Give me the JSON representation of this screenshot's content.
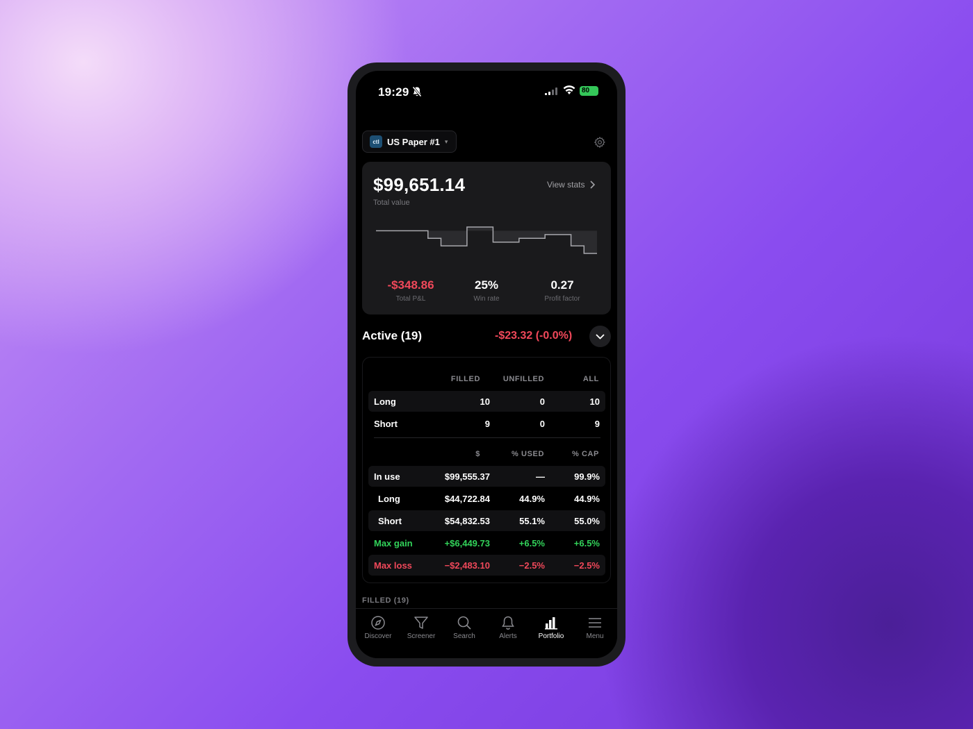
{
  "status_bar": {
    "time": "19:29",
    "battery": "80"
  },
  "account": {
    "logo_text": "ctl",
    "name": "US Paper #1"
  },
  "summary": {
    "total_value": "$99,651.14",
    "total_value_label": "Total value",
    "view_stats_label": "View stats",
    "stats": [
      {
        "value": "-$348.86",
        "label": "Total P&L"
      },
      {
        "value": "25%",
        "label": "Win rate"
      },
      {
        "value": "0.27",
        "label": "Profit factor"
      }
    ]
  },
  "equity_sparkline": {
    "type": "line",
    "values": [
      0,
      0,
      0,
      0,
      -2,
      -4,
      -4,
      1,
      1,
      -3,
      -3,
      -2,
      -2,
      -1,
      -1,
      -4,
      -6
    ]
  },
  "active": {
    "title": "Active (19)",
    "pnl": "-$23.32 (-0.0%)"
  },
  "positions_table": {
    "headers": [
      "FILLED",
      "UNFILLED",
      "ALL"
    ],
    "rows": [
      {
        "label": "Long",
        "filled": "10",
        "unfilled": "0",
        "all": "10"
      },
      {
        "label": "Short",
        "filled": "9",
        "unfilled": "0",
        "all": "9"
      }
    ]
  },
  "capital_table": {
    "headers": [
      "$",
      "% USED",
      "% CAP"
    ],
    "rows": [
      {
        "label": "In use",
        "amount": "$99,555.37",
        "used": "—",
        "cap": "99.9%"
      },
      {
        "label": "Long",
        "amount": "$44,722.84",
        "used": "44.9%",
        "cap": "44.9%"
      },
      {
        "label": "Short",
        "amount": "$54,832.53",
        "used": "55.1%",
        "cap": "55.0%"
      },
      {
        "label": "Max gain",
        "amount": "+$6,449.73",
        "used": "+6.5%",
        "cap": "+6.5%"
      },
      {
        "label": "Max loss",
        "amount": "−$2,483.10",
        "used": "−2.5%",
        "cap": "−2.5%"
      }
    ]
  },
  "filled_section": {
    "label": "FILLED (19)"
  },
  "tabbar": {
    "tabs": [
      {
        "label": "Discover",
        "icon": "compass-icon"
      },
      {
        "label": "Screener",
        "icon": "filter-icon"
      },
      {
        "label": "Search",
        "icon": "search-icon"
      },
      {
        "label": "Alerts",
        "icon": "bell-icon"
      },
      {
        "label": "Portfolio",
        "icon": "bar-chart-icon",
        "active": true
      },
      {
        "label": "Menu",
        "icon": "menu-icon"
      }
    ]
  },
  "colors": {
    "negative": "#f0485a",
    "positive": "#32d35a",
    "battery": "#34c759"
  }
}
